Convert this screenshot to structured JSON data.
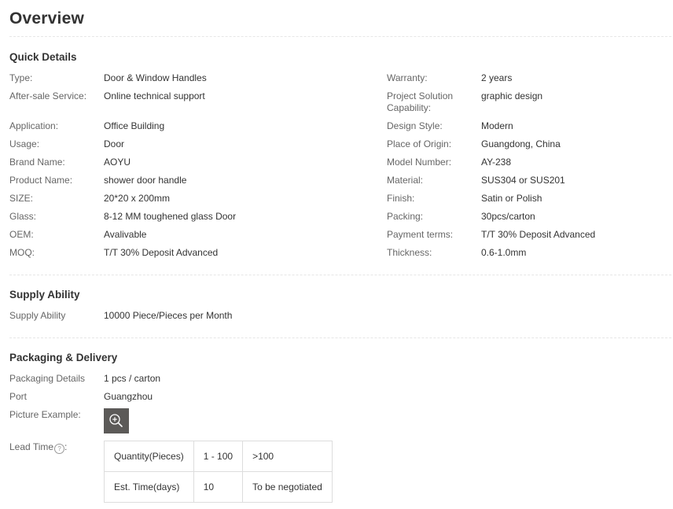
{
  "overview_title": "Overview",
  "quick_details": {
    "title": "Quick Details",
    "left": [
      {
        "label": "Type:",
        "value": "Door & Window Handles"
      },
      {
        "label": "After-sale Service:",
        "value": "Online technical support"
      },
      {
        "label": "Application:",
        "value": "Office Building"
      },
      {
        "label": "Usage:",
        "value": "Door"
      },
      {
        "label": "Brand Name:",
        "value": "AOYU"
      },
      {
        "label": "Product Name:",
        "value": "shower door handle"
      },
      {
        "label": "SIZE:",
        "value": "20*20 x 200mm"
      },
      {
        "label": "Glass:",
        "value": "8-12 MM toughened glass Door"
      },
      {
        "label": "OEM:",
        "value": "Avalivable"
      },
      {
        "label": "MOQ:",
        "value": "T/T 30% Deposit Advanced"
      }
    ],
    "right": [
      {
        "label": "Warranty:",
        "value": "2 years"
      },
      {
        "label": "Project Solution Capability:",
        "value": "graphic design"
      },
      {
        "label": "Design Style:",
        "value": "Modern"
      },
      {
        "label": "Place of Origin:",
        "value": "Guangdong, China"
      },
      {
        "label": "Model Number:",
        "value": "AY-238"
      },
      {
        "label": "Material:",
        "value": "SUS304 or SUS201"
      },
      {
        "label": "Finish:",
        "value": "Satin or Polish"
      },
      {
        "label": "Packing:",
        "value": "30pcs/carton"
      },
      {
        "label": "Payment terms:",
        "value": "T/T 30% Deposit Advanced"
      },
      {
        "label": "Thickness:",
        "value": "0.6-1.0mm"
      }
    ]
  },
  "supply_ability": {
    "title": "Supply Ability",
    "label": "Supply Ability",
    "value": "10000 Piece/Pieces per Month"
  },
  "packaging_delivery": {
    "title": "Packaging & Delivery",
    "packaging_details_label": "Packaging Details",
    "packaging_details_value": "1 pcs / carton",
    "port_label": "Port",
    "port_value": "Guangzhou",
    "picture_example_label": "Picture Example:",
    "lead_time_label": "Lead Time",
    "lead_time_suffix": ":",
    "help_glyph": "?",
    "lead_time_table": {
      "rows": [
        [
          "Quantity(Pieces)",
          "1 - 100",
          ">100"
        ],
        [
          "Est. Time(days)",
          "10",
          "To be negotiated"
        ]
      ]
    }
  },
  "icons": {
    "zoom": "zoom-in-icon",
    "help": "help-icon"
  }
}
